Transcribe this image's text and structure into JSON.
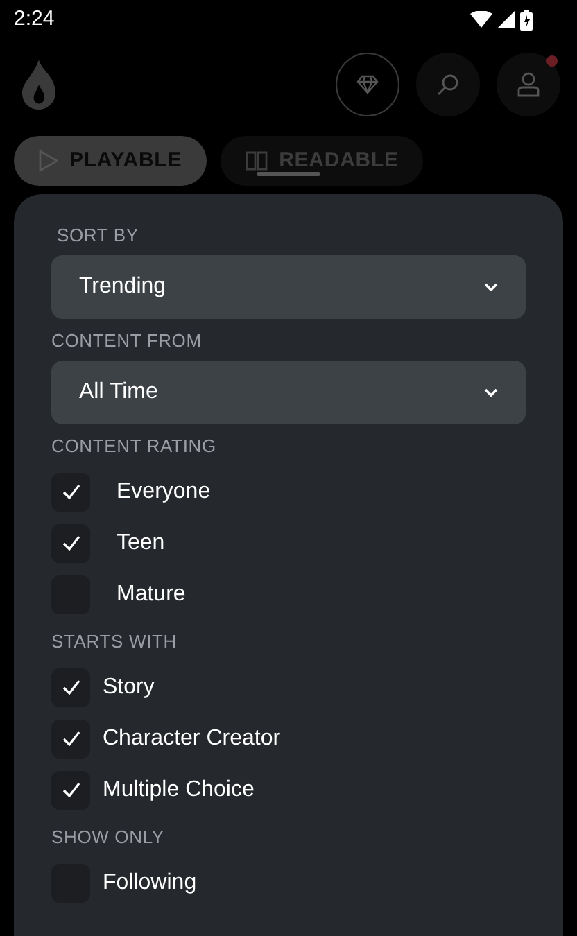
{
  "status_bar": {
    "time": "2:24"
  },
  "tabs": [
    {
      "label": "PLAYABLE",
      "selected": true
    },
    {
      "label": "READABLE",
      "selected": false
    }
  ],
  "profile": {
    "notification": true
  },
  "sections": [
    {
      "kind": "dropdown",
      "label": "SORT BY",
      "value": "Trending"
    },
    {
      "kind": "dropdown",
      "label": "CONTENT FROM",
      "value": "All Time"
    },
    {
      "kind": "checkboxes",
      "label": "CONTENT RATING",
      "items": [
        {
          "label": "Everyone",
          "checked": true
        },
        {
          "label": "Teen",
          "checked": true
        },
        {
          "label": "Mature",
          "checked": false
        }
      ]
    },
    {
      "kind": "checkboxes",
      "label": "STARTS WITH",
      "items": [
        {
          "label": "Story",
          "checked": true
        },
        {
          "label": "Character Creator",
          "checked": true
        },
        {
          "label": "Multiple Choice",
          "checked": true
        }
      ]
    },
    {
      "kind": "checkboxes",
      "label": "SHOW ONLY",
      "items": [
        {
          "label": "Following",
          "checked": false
        }
      ]
    }
  ]
}
